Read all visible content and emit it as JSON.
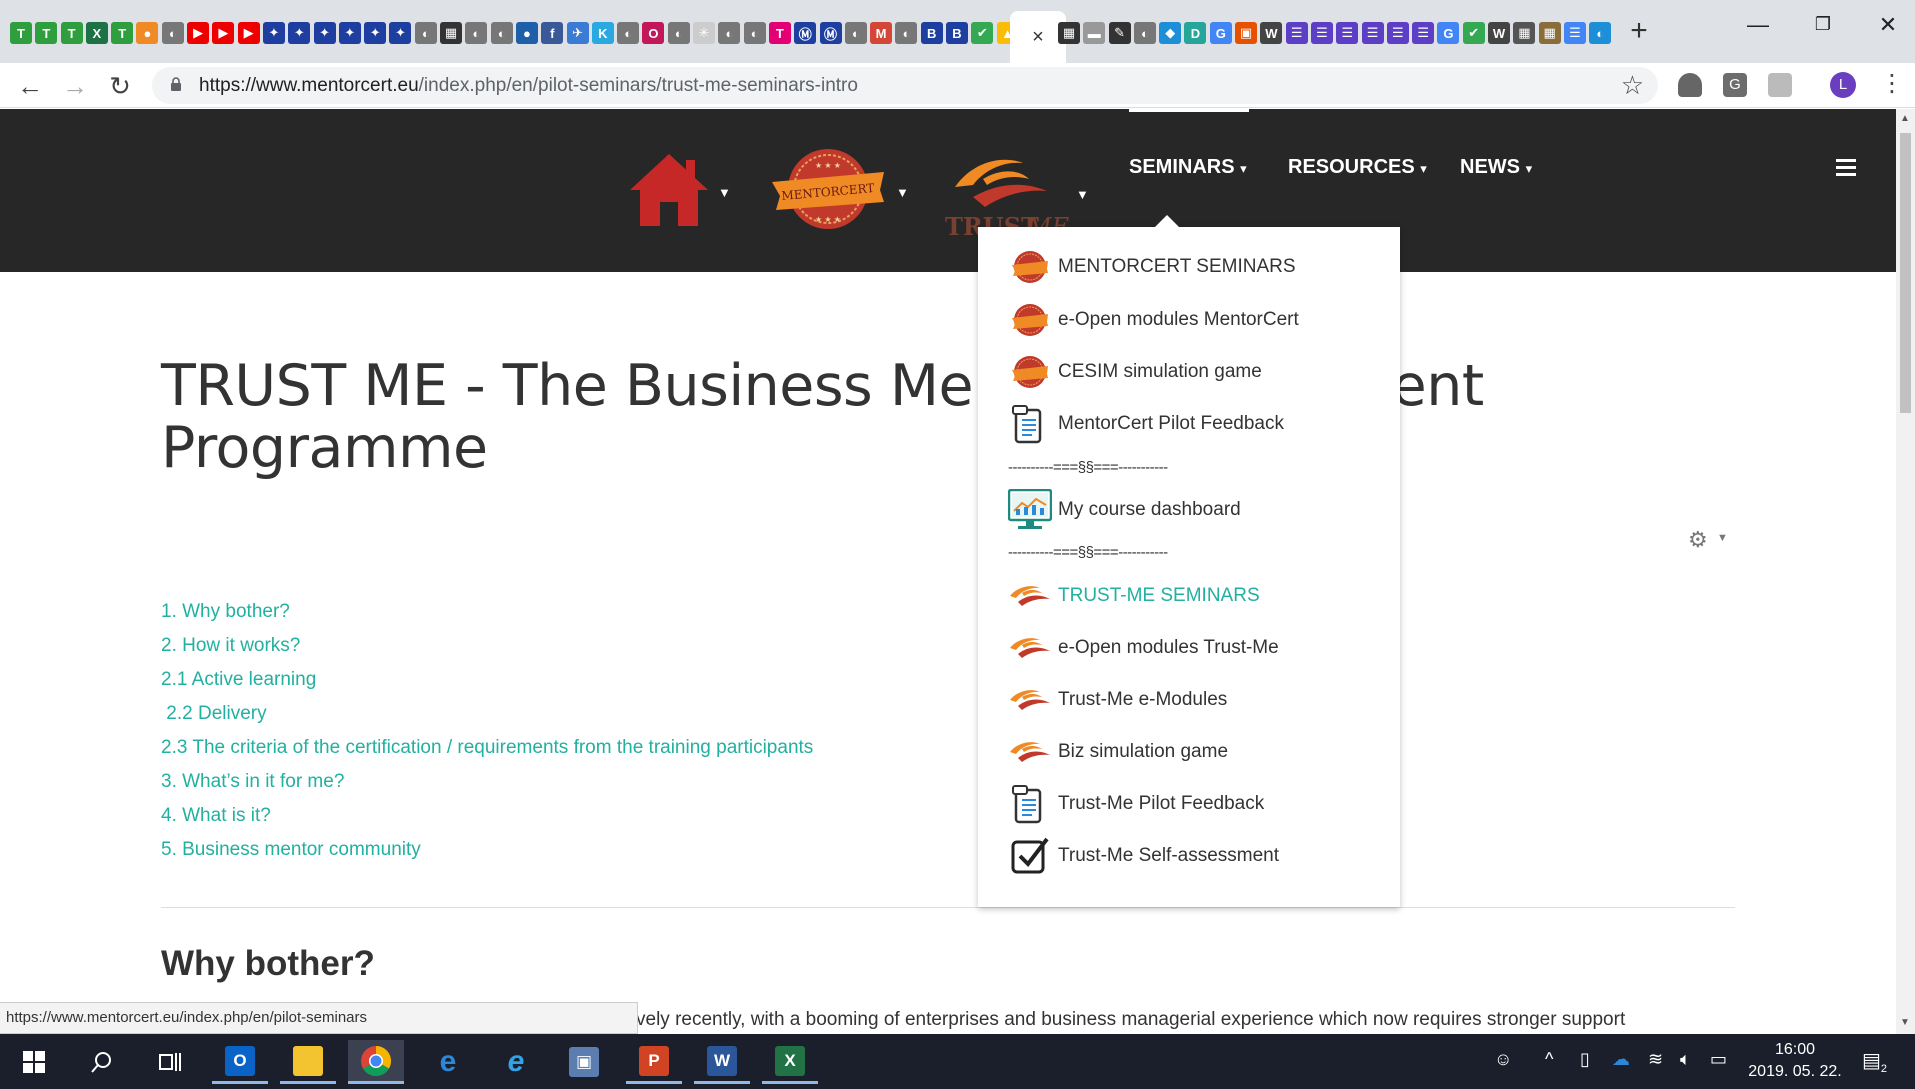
{
  "browser": {
    "url_domain": "https://www.mentorcert.eu",
    "url_path": "/index.php/en/pilot-seminars/trust-me-seminars-intro",
    "active_tab_close": "×",
    "new_tab": "+",
    "avatar_letter": "L",
    "tab_favicons": [
      {
        "c": "#2e9e3f",
        "t": "T"
      },
      {
        "c": "#2e9e3f",
        "t": "T"
      },
      {
        "c": "#2e9e3f",
        "t": "T"
      },
      {
        "c": "#1e7145",
        "t": "X"
      },
      {
        "c": "#2e9e3f",
        "t": "T"
      },
      {
        "c": "#f08a24",
        "t": "●"
      },
      {
        "c": "#777",
        "t": "◐"
      },
      {
        "c": "#e00",
        "t": "▶"
      },
      {
        "c": "#e00",
        "t": "▶"
      },
      {
        "c": "#e00",
        "t": "▶"
      },
      {
        "c": "#1f3fa0",
        "t": "✦"
      },
      {
        "c": "#1f3fa0",
        "t": "✦"
      },
      {
        "c": "#1f3fa0",
        "t": "✦"
      },
      {
        "c": "#1f3fa0",
        "t": "✦"
      },
      {
        "c": "#1f3fa0",
        "t": "✦"
      },
      {
        "c": "#1f3fa0",
        "t": "✦"
      },
      {
        "c": "#777",
        "t": "◐"
      },
      {
        "c": "#333",
        "t": "▦"
      },
      {
        "c": "#777",
        "t": "◐"
      },
      {
        "c": "#777",
        "t": "◐"
      },
      {
        "c": "#1d5fa8",
        "t": "●"
      },
      {
        "c": "#3b5998",
        "t": "f"
      },
      {
        "c": "#3a7bd5",
        "t": "✈"
      },
      {
        "c": "#2aa8e0",
        "t": "K"
      },
      {
        "c": "#777",
        "t": "◐"
      },
      {
        "c": "#c2185b",
        "t": "O"
      },
      {
        "c": "#777",
        "t": "◐"
      },
      {
        "c": "#ccc",
        "t": "✳"
      },
      {
        "c": "#777",
        "t": "◐"
      },
      {
        "c": "#777",
        "t": "◐"
      },
      {
        "c": "#e20074",
        "t": "T"
      },
      {
        "c": "#1f3fa0",
        "t": "Ⓜ"
      },
      {
        "c": "#1f3fa0",
        "t": "Ⓜ"
      },
      {
        "c": "#777",
        "t": "◐"
      },
      {
        "c": "#d44638",
        "t": "M"
      },
      {
        "c": "#777",
        "t": "◐"
      },
      {
        "c": "#1f3fa0",
        "t": "B"
      },
      {
        "c": "#1f3fa0",
        "t": "B"
      },
      {
        "c": "#34a853",
        "t": "✔"
      },
      {
        "c": "#fbbc05",
        "t": "▲"
      }
    ],
    "tab_favicons_right": [
      {
        "c": "#333",
        "t": "▦"
      },
      {
        "c": "#999",
        "t": "▬"
      },
      {
        "c": "#333",
        "t": "✎"
      },
      {
        "c": "#777",
        "t": "◐"
      },
      {
        "c": "#1d8fd6",
        "t": "◆"
      },
      {
        "c": "#26a69a",
        "t": "D"
      },
      {
        "c": "#4285f4",
        "t": "G"
      },
      {
        "c": "#e65100",
        "t": "▣"
      },
      {
        "c": "#444",
        "t": "W"
      },
      {
        "c": "#5c3fc4",
        "t": "☰"
      },
      {
        "c": "#5c3fc4",
        "t": "☰"
      },
      {
        "c": "#5c3fc4",
        "t": "☰"
      },
      {
        "c": "#5c3fc4",
        "t": "☰"
      },
      {
        "c": "#5c3fc4",
        "t": "☰"
      },
      {
        "c": "#5c3fc4",
        "t": "☰"
      },
      {
        "c": "#4285f4",
        "t": "G"
      },
      {
        "c": "#34a853",
        "t": "✔"
      },
      {
        "c": "#444",
        "t": "W"
      },
      {
        "c": "#555",
        "t": "▦"
      },
      {
        "c": "#8a6d3b",
        "t": "▦"
      },
      {
        "c": "#4285f4",
        "t": "☰"
      },
      {
        "c": "#1d8fd6",
        "t": "◐"
      }
    ]
  },
  "site": {
    "menu": [
      {
        "label": "SEMINARS",
        "caret": "▾"
      },
      {
        "label": "RESOURCES",
        "caret": "▾"
      },
      {
        "label": "NEWS",
        "caret": "▾"
      }
    ],
    "logo_trust_text": "TRUST",
    "logo_trust_me": "ME",
    "logo_cert_text": "MENTORCERT"
  },
  "dropdown": {
    "items": [
      {
        "label": "MENTORCERT SEMINARS",
        "icon": "mentorcert-badge-icon"
      },
      {
        "label": "e-Open modules MentorCert",
        "icon": "mentorcert-badge-icon"
      },
      {
        "label": "CESIM simulation game",
        "icon": "mentorcert-badge-icon"
      },
      {
        "label": "MentorCert Pilot Feedback",
        "icon": "feedback-doc-icon"
      },
      {
        "label": "----------===§§===-----------",
        "icon": "separator"
      },
      {
        "label": "My course dashboard",
        "icon": "dashboard-monitor-icon"
      },
      {
        "label": "----------===§§===-----------",
        "icon": "separator"
      },
      {
        "label": "TRUST-ME SEMINARS",
        "icon": "trustme-swoosh-icon",
        "active": true
      },
      {
        "label": "e-Open modules Trust-Me",
        "icon": "trustme-swoosh-icon"
      },
      {
        "label": "Trust-Me e-Modules",
        "icon": "trustme-swoosh-icon"
      },
      {
        "label": "Biz simulation game",
        "icon": "trustme-swoosh-icon"
      },
      {
        "label": "Trust-Me Pilot Feedback",
        "icon": "feedback-doc-icon"
      },
      {
        "label": "Trust-Me Self-assessment",
        "icon": "checkbox-icon"
      }
    ]
  },
  "article": {
    "title": "TRUST ME - The Business Mentor Development Programme",
    "toc": [
      "1. Why bother?",
      "2. How it works?",
      "2.1 Active learning",
      " 2.2 Delivery",
      "2.3 The criteria of the certification / requirements from the training participants",
      "3. What’s in it for me?",
      "4. What is it?",
      "5. Business mentor community"
    ],
    "section_heading": "Why bother?",
    "section_text": "vely recently, with a booming of enterprises and business managerial experience which now requires stronger support"
  },
  "status_url": "https://www.mentorcert.eu/index.php/en/pilot-seminars",
  "taskbar": {
    "time": "16:00",
    "date": "2019. 05. 22.",
    "notification_count": "2"
  },
  "colors": {
    "accent": "#22b0a0",
    "header_bg": "#272727",
    "home_red": "#c62828",
    "trust_orange": "#f08a24"
  }
}
